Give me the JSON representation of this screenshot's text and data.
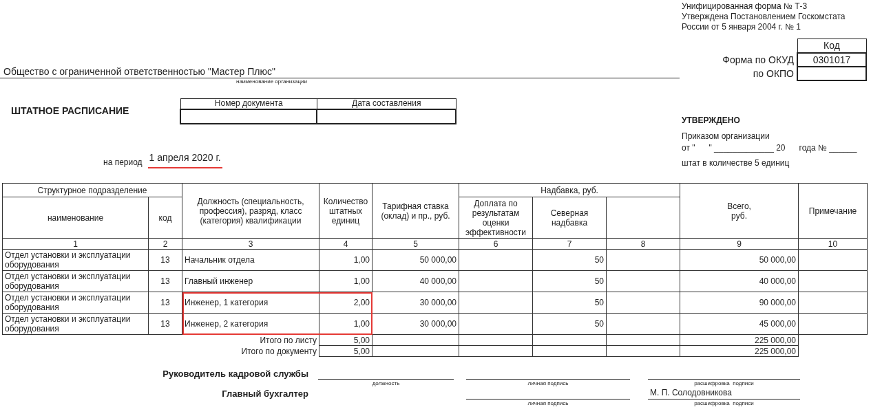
{
  "form_info": [
    "Унифицированная форма № Т-3",
    "Утверждена Постановлением Госкомстата",
    "России от 5 января 2004 г. № 1"
  ],
  "codes": {
    "header": "Код",
    "rows": [
      {
        "label": "Форма по ОКУД",
        "value": "0301017"
      },
      {
        "label": "по ОКПО"
      }
    ]
  },
  "organization": {
    "name": "Общество с ограниченной ответственностью \"Мастер Плюс\"",
    "caption": "наименование организации"
  },
  "document": {
    "title": "ШТАТНОЕ РАСПИСАНИЕ",
    "columns": [
      "Номер документа",
      "Дата составления"
    ]
  },
  "period": {
    "label": "на период",
    "value": "1 апреля 2020 г.",
    "underlined": true
  },
  "approval": {
    "title": "УТВЕРЖДЕНО",
    "lines": [
      "Приказом организации",
      "от \"      \" _____________ 20      года № ______",
      "штат в количестве 5 единиц"
    ]
  },
  "table": {
    "columns": [
      {
        "group": "Структурное  подразделение",
        "columns": [
          {
            "label": "наименование"
          },
          {
            "label": "код"
          }
        ]
      },
      {
        "label": "Должность (специальность, профессия), разряд, класс (категория) квалификации"
      },
      {
        "label": "Количество штатных единиц"
      },
      {
        "label": "Тарифная ставка (оклад) и пр., руб."
      },
      {
        "group": "Надбавка, руб.",
        "columns": [
          {
            "label": "Доплата по результатам оценки эффективности"
          },
          {
            "label": "Северная надбавка"
          },
          {}
        ]
      },
      {
        "label": "Всего,\nруб."
      },
      {
        "label": "Примечание"
      }
    ],
    "numbers": [
      "1",
      "2",
      "3",
      "4",
      "5",
      "6",
      "7",
      "8",
      "9",
      "10"
    ],
    "rows": [
      {
        "department": "Отдел установки и эксплуатации оборудования",
        "code": "13",
        "position": "Начальник отдела",
        "count": "1,00",
        "rate": "50 000,00",
        "north_bonus": "50",
        "total": "50 000,00",
        "highlighted": false
      },
      {
        "department": "Отдел установки и эксплуатации оборудования",
        "code": "13",
        "position": "Главный инженер",
        "count": "1,00",
        "rate": "40 000,00",
        "north_bonus": "50",
        "total": "40 000,00",
        "highlighted": false
      },
      {
        "department": "Отдел установки и эксплуатации оборудования",
        "code": "13",
        "position": "Инженер, 1 категория",
        "count": "2,00",
        "rate": "30 000,00",
        "north_bonus": "50",
        "total": "90 000,00",
        "highlighted": true
      },
      {
        "department": "Отдел установки и эксплуатации оборудования",
        "code": "13",
        "position": "Инженер, 2 категория",
        "count": "1,00",
        "rate": "30 000,00",
        "north_bonus": "50",
        "total": "45 000,00",
        "highlighted": true
      }
    ],
    "totals": [
      {
        "label": "Итого по листу",
        "count": "5,00",
        "total": "225 000,00"
      },
      {
        "label": "Итого по документу",
        "count": "5,00",
        "total": "225 000,00"
      }
    ]
  },
  "signatures": [
    {
      "role": "Руководитель кадровой службы",
      "position_caption": "должность",
      "signature_caption": "личная подпись",
      "name_caption": "расшифровка  подписи"
    },
    {
      "role": "Главный бухгалтер",
      "signature_caption": "личная подпись",
      "name": "М. П. Солодовникова",
      "name_caption": "расшифровка  подписи"
    }
  ]
}
